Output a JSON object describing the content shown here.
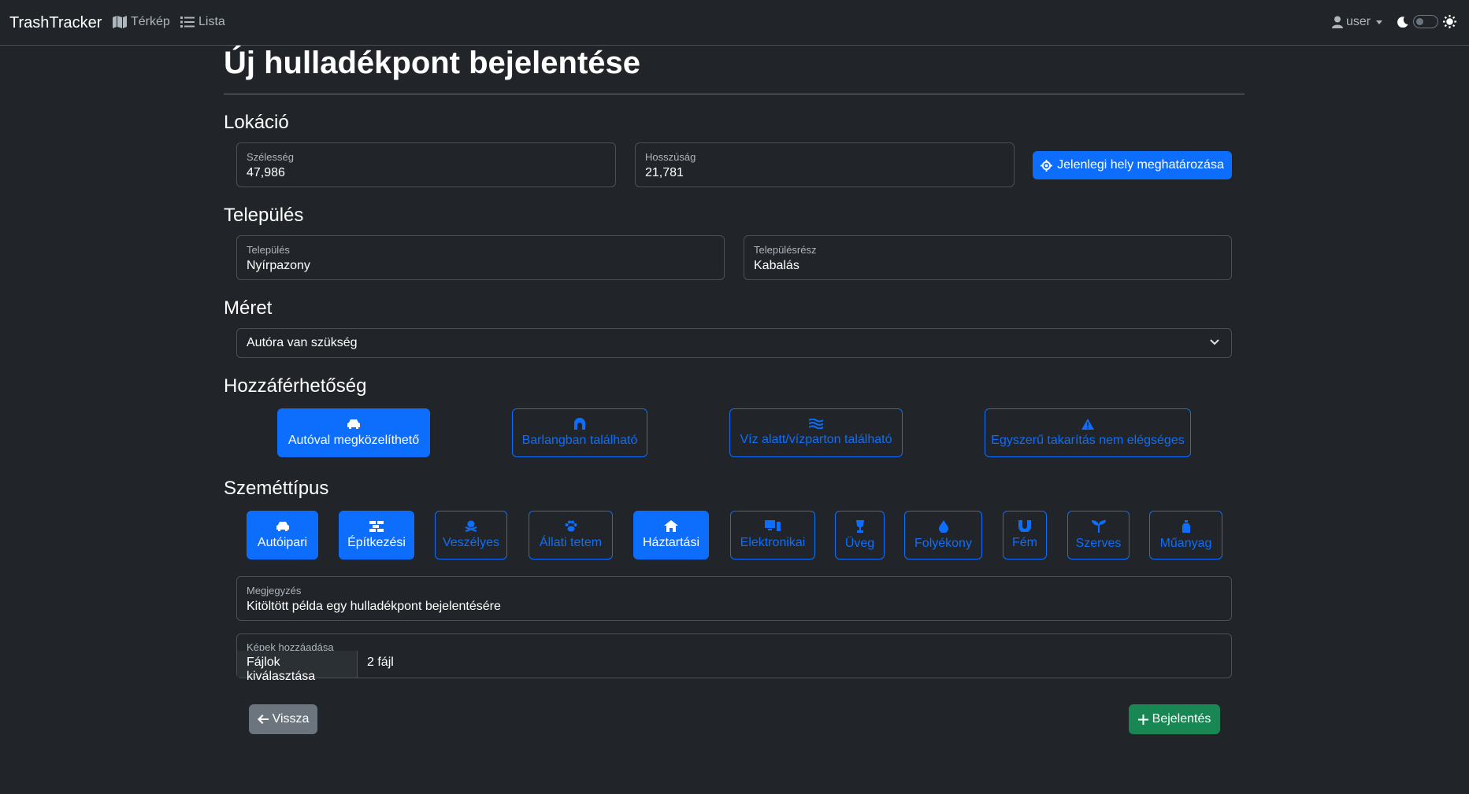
{
  "navbar": {
    "brand": "TrashTracker",
    "map_label": "Térkép",
    "list_label": "Lista",
    "user_label": "user"
  },
  "page": {
    "title": "Új hulladékpont bejelentése"
  },
  "location": {
    "heading": "Lokáció",
    "latitude_label": "Szélesség",
    "latitude_value": "47,986",
    "longitude_label": "Hosszúság",
    "longitude_value": "21,781",
    "locate_button": "Jelenlegi hely meghatározása"
  },
  "settlement": {
    "heading": "Település",
    "town_label": "Település",
    "town_value": "Nyírpazony",
    "district_label": "Településrész",
    "district_value": "Kabalás"
  },
  "size": {
    "heading": "Méret",
    "selected": "Autóra van szükség"
  },
  "accessibility": {
    "heading": "Hozzáférhetőség",
    "options": [
      {
        "label": "Autóval megközelíthető",
        "icon": "car-icon",
        "selected": true
      },
      {
        "label": "Barlangban található",
        "icon": "cave-icon",
        "selected": false
      },
      {
        "label": "Víz alatt/vízparton található",
        "icon": "water-icon",
        "selected": false
      },
      {
        "label": "Egyszerű takarítás nem elégséges",
        "icon": "warning-icon",
        "selected": false
      }
    ]
  },
  "trash_type": {
    "heading": "Szeméttípus",
    "options": [
      {
        "label": "Autóipari",
        "icon": "car-icon",
        "selected": true
      },
      {
        "label": "Építkezési",
        "icon": "bricks-icon",
        "selected": true
      },
      {
        "label": "Veszélyes",
        "icon": "skull-icon",
        "selected": false
      },
      {
        "label": "Állati tetem",
        "icon": "paw-icon",
        "selected": false
      },
      {
        "label": "Háztartási",
        "icon": "house-icon",
        "selected": true
      },
      {
        "label": "Elektronikai",
        "icon": "computer-icon",
        "selected": false
      },
      {
        "label": "Üveg",
        "icon": "glass-icon",
        "selected": false
      },
      {
        "label": "Folyékony",
        "icon": "droplet-icon",
        "selected": false
      },
      {
        "label": "Fém",
        "icon": "magnet-icon",
        "selected": false
      },
      {
        "label": "Szerves",
        "icon": "sprout-icon",
        "selected": false
      },
      {
        "label": "Műanyag",
        "icon": "bottle-icon",
        "selected": false
      }
    ]
  },
  "note": {
    "label": "Megjegyzés",
    "value": "Kitöltött példa egy hulladékpont bejelentésére"
  },
  "images": {
    "label": "Képek hozzáadása",
    "button": "Fájlok kiválasztása",
    "count": "2 fájl"
  },
  "actions": {
    "back": "Vissza",
    "submit": "Bejelentés"
  },
  "colors": {
    "background": "#212529",
    "primary": "#0d6efd",
    "success": "#198754",
    "secondary": "#6c757d"
  }
}
